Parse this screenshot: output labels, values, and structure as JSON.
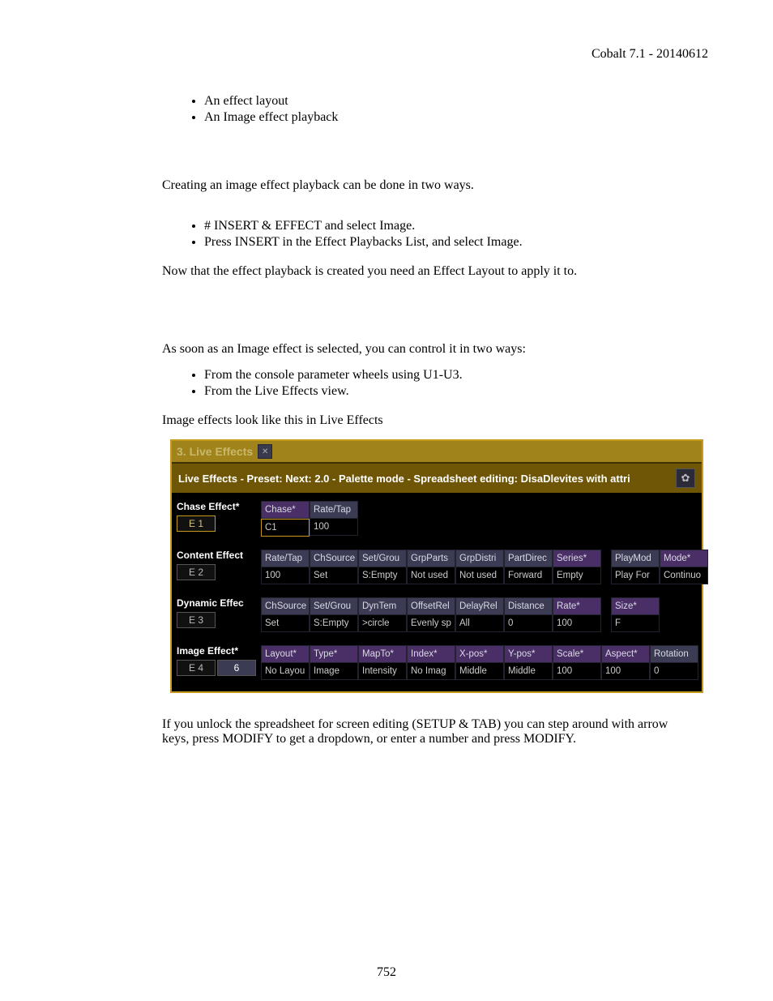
{
  "header": "Cobalt 7.1 - 20140612",
  "bullets_top": [
    "An effect layout",
    "An Image effect playback"
  ],
  "para1": "Creating an image effect playback can be done in two ways.",
  "bullets_create": [
    "# INSERT & EFFECT and select Image.",
    "Press INSERT in the Effect Playbacks List, and select Image."
  ],
  "para2": "Now that the effect playback is created you need an Effect Layout to apply it to.",
  "para3": "As soon as an Image effect is selected, you can control it in two ways:",
  "bullets_control": [
    "From the console parameter wheels using U1-U3.",
    "From the Live Effects view."
  ],
  "para4": "Image effects look like this in Live Effects",
  "panel": {
    "tab_title": "3. Live Effects",
    "subheader": "Live Effects - Preset:  Next: 2.0 - Palette mode - Spreadsheet editing: DisaDlevites with attri",
    "rows": [
      {
        "label": "Chase Effect*",
        "ebox": "E 1",
        "ebox_sel": true,
        "headers": [
          "Chase*",
          "Rate/Tap"
        ],
        "header_purple": [
          true,
          false
        ],
        "values": [
          "C1",
          "100"
        ],
        "val_sel": [
          true,
          false
        ]
      },
      {
        "label": "Content Effect",
        "ebox": "E 2",
        "headers": [
          "Rate/Tap",
          "ChSource",
          "Set/Grou",
          "GrpParts",
          "GrpDistri",
          "PartDirec",
          "Series*",
          "PlayMod",
          "Mode*"
        ],
        "header_purple": [
          false,
          false,
          false,
          false,
          false,
          false,
          true,
          false,
          true
        ],
        "gap_after": 6,
        "values": [
          "100",
          "Set",
          "S:Empty",
          "Not used",
          "Not used",
          "Forward",
          "Empty",
          "Play For",
          "Continuo"
        ]
      },
      {
        "label": "Dynamic Effec",
        "ebox": "E 3",
        "headers": [
          "ChSource",
          "Set/Grou",
          "DynTem",
          "OffsetRel",
          "DelayRel",
          "Distance",
          "Rate*",
          "Size*"
        ],
        "header_purple": [
          false,
          false,
          false,
          false,
          false,
          false,
          true,
          true
        ],
        "gap_after": 6,
        "values": [
          "Set",
          "S:Empty",
          ">circle",
          "Evenly sp",
          "All",
          "0",
          "100",
          "F"
        ]
      },
      {
        "label": "Image Effect*",
        "ebox": "E 4",
        "ebox2": "6",
        "headers": [
          "Layout*",
          "Type*",
          "MapTo*",
          "Index*",
          "X-pos*",
          "Y-pos*",
          "Scale*",
          "Aspect*",
          "Rotation"
        ],
        "header_purple": [
          true,
          true,
          true,
          true,
          true,
          true,
          true,
          true,
          false
        ],
        "values": [
          "No Layou",
          "Image",
          "Intensity",
          "No Imag",
          "Middle",
          "Middle",
          "100",
          "100",
          "0"
        ]
      }
    ]
  },
  "para5": "If you unlock the spreadsheet for screen editing (SETUP & TAB) you can step around with arrow keys, press MODIFY to get a dropdown, or enter a number and press MODIFY.",
  "pagenum": "752"
}
